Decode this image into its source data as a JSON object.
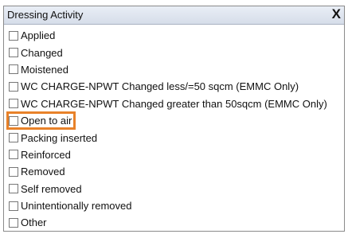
{
  "panel": {
    "title": "Dressing Activity",
    "close_label": "X"
  },
  "options": [
    {
      "label": "Applied",
      "checked": false
    },
    {
      "label": "Changed",
      "checked": false
    },
    {
      "label": "Moistened",
      "checked": false
    },
    {
      "label": "WC CHARGE-NPWT Changed less/=50 sqcm (EMMC Only)",
      "checked": false
    },
    {
      "label": "WC CHARGE-NPWT Changed greater than 50sqcm (EMMC Only)",
      "checked": false
    },
    {
      "label": "Open to air",
      "checked": false,
      "highlighted": true
    },
    {
      "label": "Packing inserted",
      "checked": false
    },
    {
      "label": "Reinforced",
      "checked": false
    },
    {
      "label": "Removed",
      "checked": false
    },
    {
      "label": "Self removed",
      "checked": false
    },
    {
      "label": "Unintentionally removed",
      "checked": false
    },
    {
      "label": "Other",
      "checked": false
    }
  ],
  "colors": {
    "highlight": "#e8822a",
    "header_bg": "#dfe5ef",
    "border": "#8a8a8a"
  }
}
